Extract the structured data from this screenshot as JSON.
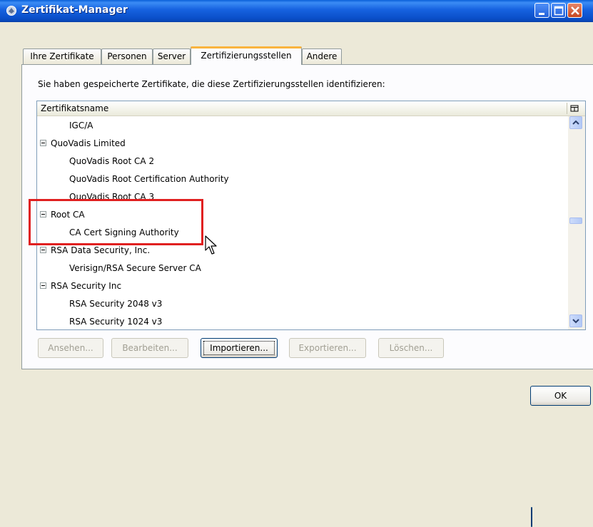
{
  "window": {
    "title": "Zertifikat-Manager",
    "minimize_label": "",
    "maximize_label": "",
    "close_label": ""
  },
  "tabs": [
    {
      "label": "Ihre Zertifikate",
      "active": false
    },
    {
      "label": "Personen",
      "active": false
    },
    {
      "label": "Server",
      "active": false
    },
    {
      "label": "Zertifizierungsstellen",
      "active": true
    },
    {
      "label": "Andere",
      "active": false
    }
  ],
  "panel": {
    "intro": "Sie haben gespeicherte Zertifikate, die diese Zertifizierungsstellen identifizieren:",
    "column_header": "Zertifikatsname"
  },
  "tree": {
    "rows": [
      {
        "type": "leaf",
        "label": "IGC/A"
      },
      {
        "type": "group",
        "label": "QuoVadis Limited"
      },
      {
        "type": "leaf",
        "label": "QuoVadis Root CA 2"
      },
      {
        "type": "leaf",
        "label": "QuoVadis Root Certification Authority"
      },
      {
        "type": "leaf",
        "label": "QuoVadis Root CA 3"
      },
      {
        "type": "group",
        "label": "Root CA"
      },
      {
        "type": "leaf",
        "label": "CA Cert Signing Authority"
      },
      {
        "type": "group",
        "label": "RSA Data Security, Inc."
      },
      {
        "type": "leaf",
        "label": "Verisign/RSA Secure Server CA"
      },
      {
        "type": "group",
        "label": "RSA Security Inc"
      },
      {
        "type": "leaf",
        "label": "RSA Security 2048 v3"
      },
      {
        "type": "leaf",
        "label": "RSA Security 1024 v3"
      }
    ]
  },
  "buttons": {
    "view": "Ansehen...",
    "edit": "Bearbeiten...",
    "import": "Importieren...",
    "export": "Exportieren...",
    "delete": "Löschen...",
    "ok": "OK"
  },
  "colors": {
    "titlebar": "#0a4fc9",
    "active_tab_accent": "#f9b43e",
    "highlight": "#e02020"
  },
  "icons": [
    "app-icon",
    "minimize-icon",
    "maximize-icon",
    "close-icon",
    "column-picker-icon",
    "scroll-up-arrow-icon",
    "scroll-down-arrow-icon",
    "mouse-cursor-icon"
  ]
}
